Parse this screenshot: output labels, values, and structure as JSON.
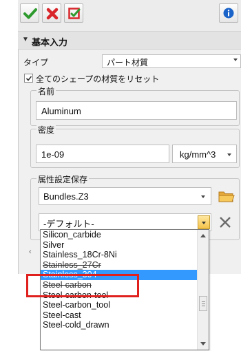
{
  "colors": {
    "check_green": "#2e9a2e",
    "x_red": "#d8262b",
    "accent_blue": "#3399ff",
    "info_blue": "#1a63c8",
    "highlight_red": "#e0201d"
  },
  "toolbar": {
    "accept_icon": "check-icon",
    "cancel_icon": "x-icon",
    "apply_icon": "apply-icon",
    "info_icon": "info-icon"
  },
  "section": {
    "title": "基本入力"
  },
  "type_row": {
    "label": "タイプ",
    "value": "パート材質"
  },
  "reset_checkbox": {
    "checked": true,
    "label": "全てのシェープの材質をリセット"
  },
  "name_group": {
    "title": "名前",
    "value": "Aluminum"
  },
  "density_group": {
    "title": "密度",
    "value": "1e-09",
    "unit": "kg/mm^3"
  },
  "attr_group": {
    "title": "属性設定保存",
    "file_value": "Bundles.Z3",
    "preset_value": "-デフォルト-"
  },
  "dropdown": {
    "selected_index": 4,
    "items": [
      "Silicon_carbide",
      "Silver",
      "Stainless_18Cr-8Ni",
      "Stainless_27Cr",
      "Stainless_304",
      "Steel-carbon",
      "Steel-carbon-tool",
      "Steel-carbon_tool",
      "Steel-cast",
      "Steel-cold_drawn"
    ]
  }
}
